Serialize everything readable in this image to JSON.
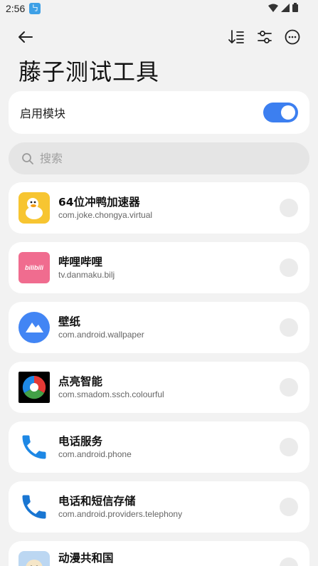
{
  "status_bar": {
    "time": "2:56",
    "app_icon_glyph": "㇉"
  },
  "toolbar": {
    "back_icon": "arrow-left-icon",
    "sort_icon": "sort-icon",
    "filter_icon": "sliders-icon",
    "more_icon": "more-horizontal-icon"
  },
  "page": {
    "title": "藤子测试工具"
  },
  "module": {
    "label": "启用模块",
    "enabled": true,
    "accent": "#3c7ff0"
  },
  "search": {
    "placeholder": "搜索",
    "value": ""
  },
  "apps": [
    {
      "name": "64位冲鸭加速器",
      "package": "com.joke.chongya.virtual",
      "checked": false
    },
    {
      "name": "哔哩哔哩",
      "package": "tv.danmaku.bilj",
      "checked": false,
      "icon_text": "bilibili"
    },
    {
      "name": "壁纸",
      "package": "com.android.wallpaper",
      "checked": false
    },
    {
      "name": "点亮智能",
      "package": "com.smadom.ssch.colourful",
      "checked": false
    },
    {
      "name": "电话服务",
      "package": "com.android.phone",
      "checked": false
    },
    {
      "name": "电话和短信存储",
      "package": "com.android.providers.telephony",
      "checked": false
    },
    {
      "name": "动漫共和国",
      "package": "",
      "checked": false
    }
  ]
}
